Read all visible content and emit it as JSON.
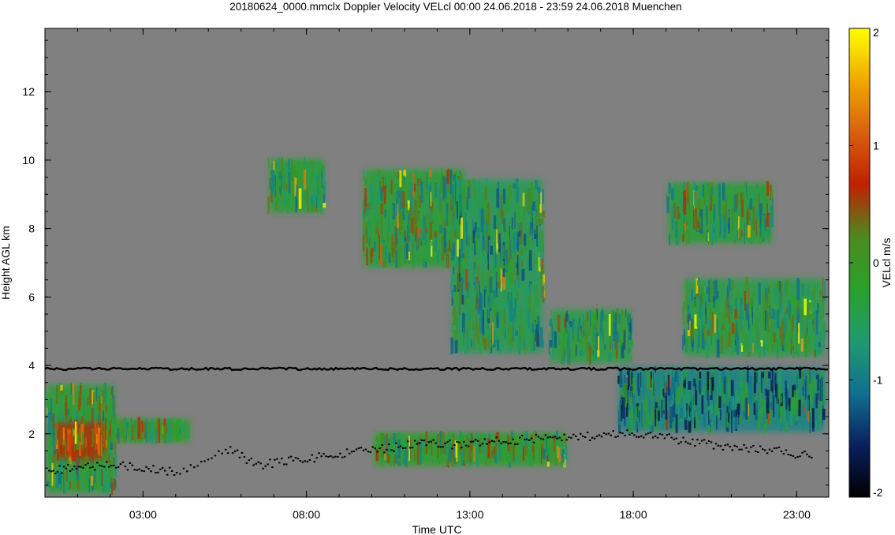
{
  "chart_data": {
    "type": "heatmap",
    "title": "20180624_0000.mmclx Doppler Velocity VELcl   00:00 24.06.2018 - 23:59 24.06.2018 Muenchen",
    "xlabel": "Time UTC",
    "ylabel": "Height AGL km",
    "xlim": [
      0.0,
      23.98
    ],
    "ylim": [
      0.15,
      13.85
    ],
    "x_ticks": [
      {
        "value": 3,
        "label": "03:00"
      },
      {
        "value": 8,
        "label": "08:00"
      },
      {
        "value": 13,
        "label": "13:00"
      },
      {
        "value": 18,
        "label": "18:00"
      },
      {
        "value": 23,
        "label": "23:00"
      }
    ],
    "y_ticks": [
      {
        "value": 2,
        "label": "2"
      },
      {
        "value": 4,
        "label": "4"
      },
      {
        "value": 6,
        "label": "6"
      },
      {
        "value": 8,
        "label": "8"
      },
      {
        "value": 10,
        "label": "10"
      },
      {
        "value": 12,
        "label": "12"
      }
    ],
    "colorbar": {
      "label": "VELcl m/s",
      "range": [
        -2,
        2
      ],
      "ticks": [
        {
          "value": 2,
          "label": "2"
        },
        {
          "value": 1,
          "label": "1"
        },
        {
          "value": 0,
          "label": "0"
        },
        {
          "value": -1,
          "label": "-1"
        },
        {
          "value": -2,
          "label": "-2"
        }
      ],
      "colors": [
        "#000000",
        "#0a2060",
        "#117090",
        "#1f9a70",
        "#2aa02a",
        "#4c8a20",
        "#c02000",
        "#d86010",
        "#f0a800",
        "#ffff00"
      ]
    },
    "background_color": "#808080",
    "velocity_regions": [
      {
        "t0": 0.0,
        "t1": 2.2,
        "h0": 0.2,
        "h1": 3.5,
        "velocity": -0.3
      },
      {
        "t0": 0.3,
        "t1": 1.9,
        "h0": 1.2,
        "h1": 2.4,
        "velocity": 0.6
      },
      {
        "t0": 1.8,
        "t1": 4.5,
        "h0": 1.7,
        "h1": 2.5,
        "velocity": -0.1
      },
      {
        "t0": 6.8,
        "t1": 8.6,
        "h0": 8.4,
        "h1": 10.1,
        "velocity": -0.3
      },
      {
        "t0": 9.7,
        "t1": 12.9,
        "h0": 6.8,
        "h1": 9.8,
        "velocity": -0.3
      },
      {
        "t0": 12.4,
        "t1": 15.3,
        "h0": 4.3,
        "h1": 9.5,
        "velocity": -0.5
      },
      {
        "t0": 15.4,
        "t1": 18.0,
        "h0": 4.0,
        "h1": 5.7,
        "velocity": -0.4
      },
      {
        "t0": 17.5,
        "t1": 23.9,
        "h0": 2.0,
        "h1": 4.0,
        "velocity": -0.9
      },
      {
        "t0": 19.0,
        "t1": 22.3,
        "h0": 7.5,
        "h1": 9.4,
        "velocity": -0.3
      },
      {
        "t0": 19.5,
        "t1": 23.9,
        "h0": 4.2,
        "h1": 6.6,
        "velocity": -0.4
      },
      {
        "t0": 10.0,
        "t1": 16.0,
        "h0": 1.0,
        "h1": 2.1,
        "velocity": -0.2
      }
    ],
    "black_line_height": 3.9,
    "boundary_layer_tops": [
      [
        0.1,
        0.95
      ],
      [
        1.0,
        1.05
      ],
      [
        2.0,
        1.12
      ],
      [
        3.0,
        1.0
      ],
      [
        4.0,
        0.9
      ],
      [
        5.5,
        1.6
      ],
      [
        6.5,
        1.1
      ],
      [
        7.5,
        1.25
      ],
      [
        8.5,
        1.35
      ],
      [
        9.5,
        1.5
      ],
      [
        10.5,
        1.6
      ],
      [
        11.5,
        1.75
      ],
      [
        12.5,
        1.7
      ],
      [
        13.5,
        1.8
      ],
      [
        14.5,
        1.85
      ],
      [
        15.5,
        1.95
      ],
      [
        16.5,
        1.95
      ],
      [
        17.5,
        2.0
      ],
      [
        18.5,
        2.05
      ],
      [
        19.5,
        1.8
      ],
      [
        20.5,
        1.7
      ],
      [
        21.5,
        1.6
      ],
      [
        22.5,
        1.5
      ],
      [
        23.5,
        1.35
      ]
    ]
  }
}
